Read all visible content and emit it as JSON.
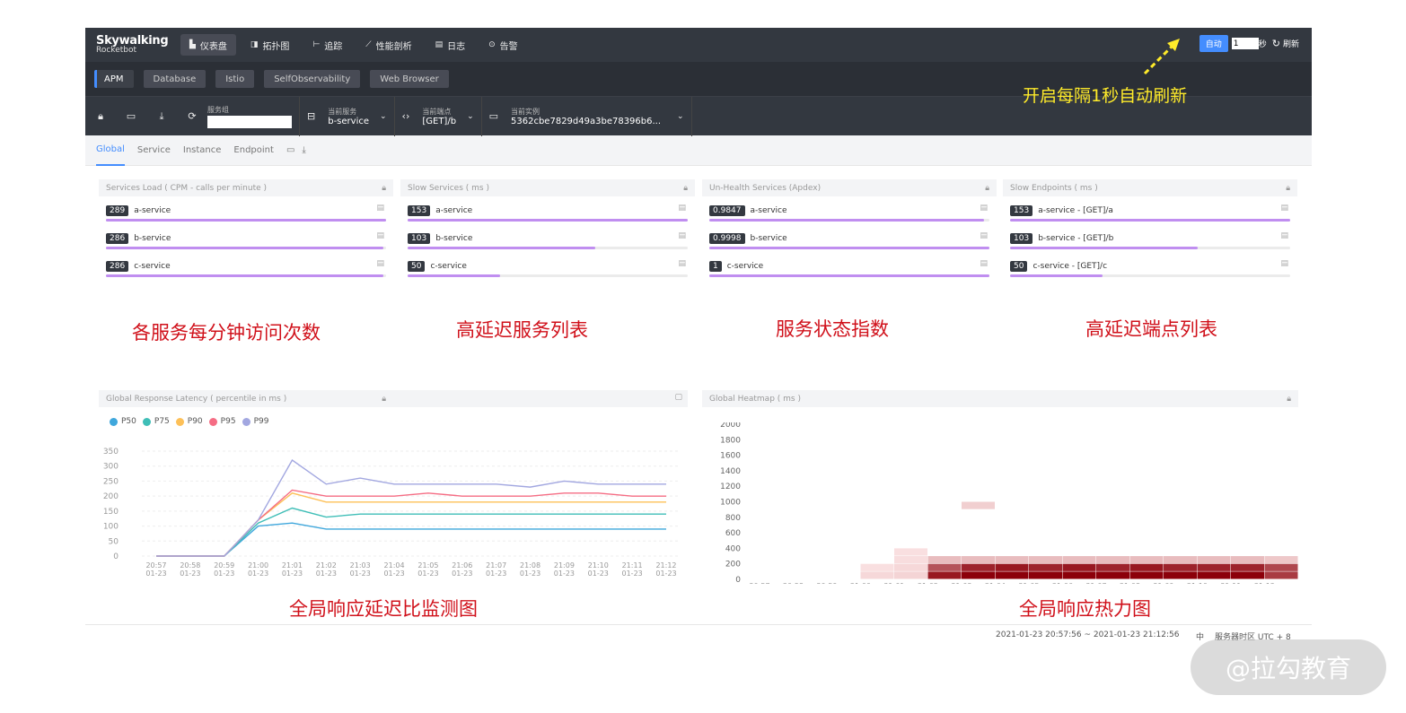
{
  "nav": {
    "logo_line1": "Skywalking",
    "logo_line2": "Rocketbot",
    "items": [
      {
        "label": "仪表盘",
        "icon": "dashboard-icon",
        "glyph": "▙"
      },
      {
        "label": "拓扑图",
        "icon": "topology-icon",
        "glyph": "◨"
      },
      {
        "label": "追踪",
        "icon": "trace-icon",
        "glyph": "⊢"
      },
      {
        "label": "性能剖析",
        "icon": "profile-icon",
        "glyph": "⟋"
      },
      {
        "label": "日志",
        "icon": "log-icon",
        "glyph": "▤"
      },
      {
        "label": "告警",
        "icon": "alarm-icon",
        "glyph": "⊙"
      }
    ],
    "auto_label": "自动",
    "interval_value": "1",
    "seconds_label": "秒",
    "refresh_label": "刷新"
  },
  "subnav": {
    "tabs": [
      "APM",
      "Database",
      "Istio",
      "SelfObservability",
      "Web Browser"
    ]
  },
  "toolbar": {
    "group_label": "服务组",
    "service_label": "当前服务",
    "service_value": "b-service",
    "endpoint_label": "当前端点",
    "endpoint_value": "[GET]/b",
    "instance_label": "当前实例",
    "instance_value": "5362cbe7829d49a3be78396b6..."
  },
  "lightbar": {
    "tabs": [
      "Global",
      "Service",
      "Instance",
      "Endpoint"
    ]
  },
  "panels": [
    {
      "title": "Services Load ( CPM - calls per minute )",
      "rows": [
        {
          "value": "289",
          "name": "a-service",
          "fill": 1.0
        },
        {
          "value": "286",
          "name": "b-service",
          "fill": 0.99
        },
        {
          "value": "286",
          "name": "c-service",
          "fill": 0.99
        }
      ]
    },
    {
      "title": "Slow Services ( ms )",
      "rows": [
        {
          "value": "153",
          "name": "a-service",
          "fill": 1.0
        },
        {
          "value": "103",
          "name": "b-service",
          "fill": 0.67
        },
        {
          "value": "50",
          "name": "c-service",
          "fill": 0.33
        }
      ]
    },
    {
      "title": "Un-Health Services (Apdex)",
      "rows": [
        {
          "value": "0.9847",
          "name": "a-service",
          "fill": 0.98
        },
        {
          "value": "0.9998",
          "name": "b-service",
          "fill": 1.0
        },
        {
          "value": "1",
          "name": "c-service",
          "fill": 1.0
        }
      ]
    },
    {
      "title": "Slow Endpoints ( ms )",
      "rows": [
        {
          "value": "153",
          "name": "a-service - [GET]/a",
          "fill": 1.0
        },
        {
          "value": "103",
          "name": "b-service - [GET]/b",
          "fill": 0.67
        },
        {
          "value": "50",
          "name": "c-service - [GET]/c",
          "fill": 0.33
        }
      ]
    }
  ],
  "annotations": {
    "a1": "各服务每分钟访问次数",
    "a2": "高延迟服务列表",
    "a3": "服务状态指数",
    "a4": "高延迟端点列表",
    "a5": "全局响应延迟比监测图",
    "a6": "全局响应热力图",
    "auto_note": "开启每隔1秒自动刷新"
  },
  "latency": {
    "title": "Global Response Latency ( percentile in ms )",
    "chart_data": {
      "type": "line",
      "x": [
        "20:57\n01-23",
        "20:58\n01-23",
        "20:59\n01-23",
        "21:00\n01-23",
        "21:01\n01-23",
        "21:02\n01-23",
        "21:03\n01-23",
        "21:04\n01-23",
        "21:05\n01-23",
        "21:06\n01-23",
        "21:07\n01-23",
        "21:08\n01-23",
        "21:09\n01-23",
        "21:10\n01-23",
        "21:11\n01-23",
        "21:12\n01-23"
      ],
      "ylim": [
        0,
        350
      ],
      "yticks": [
        0,
        50,
        100,
        150,
        200,
        250,
        300,
        350
      ],
      "series": [
        {
          "name": "P50",
          "color": "#3fa7dc",
          "values": [
            0,
            0,
            0,
            100,
            110,
            90,
            90,
            90,
            90,
            90,
            90,
            90,
            90,
            90,
            90,
            90
          ]
        },
        {
          "name": "P75",
          "color": "#3fbeb7",
          "values": [
            0,
            0,
            0,
            110,
            160,
            130,
            140,
            140,
            140,
            140,
            140,
            140,
            140,
            140,
            140,
            140
          ]
        },
        {
          "name": "P90",
          "color": "#fdc058",
          "values": [
            0,
            0,
            0,
            120,
            210,
            180,
            180,
            180,
            180,
            180,
            180,
            180,
            180,
            180,
            180,
            180
          ]
        },
        {
          "name": "P95",
          "color": "#f56d84",
          "values": [
            0,
            0,
            0,
            120,
            220,
            200,
            200,
            200,
            210,
            200,
            200,
            200,
            210,
            210,
            200,
            200
          ]
        },
        {
          "name": "P99",
          "color": "#a2a7e0",
          "values": [
            0,
            0,
            0,
            120,
            320,
            240,
            260,
            240,
            240,
            240,
            240,
            230,
            250,
            240,
            240,
            240
          ]
        }
      ]
    }
  },
  "heatmap": {
    "title": "Global Heatmap ( ms )",
    "chart_data": {
      "type": "heatmap",
      "x": [
        "20:57\n01-23",
        "20:58\n01-23",
        "20:59\n01-23",
        "21:00\n01-23",
        "21:01\n01-23",
        "21:02\n01-23",
        "21:03\n01-23",
        "21:04\n01-23",
        "21:05\n01-23",
        "21:06\n01-23",
        "21:07\n01-23",
        "21:08\n01-23",
        "21:09\n01-23",
        "21:10\n01-23",
        "21:11\n01-23",
        "21:12\n01-23"
      ],
      "yticks": [
        0,
        200,
        400,
        600,
        800,
        1000,
        1200,
        1400,
        1600,
        1800,
        2000
      ],
      "ylim": [
        0,
        2000
      ],
      "bucket_size": 100,
      "cells": [
        {
          "x": 3,
          "b": 0,
          "v": 0.08
        },
        {
          "x": 3,
          "b": 1,
          "v": 0.05
        },
        {
          "x": 4,
          "b": 0,
          "v": 0.1
        },
        {
          "x": 4,
          "b": 1,
          "v": 0.08
        },
        {
          "x": 4,
          "b": 2,
          "v": 0.06
        },
        {
          "x": 4,
          "b": 3,
          "v": 0.05
        },
        {
          "x": 5,
          "b": 0,
          "v": 0.9
        },
        {
          "x": 5,
          "b": 1,
          "v": 0.65
        },
        {
          "x": 5,
          "b": 2,
          "v": 0.2
        },
        {
          "x": 6,
          "b": 0,
          "v": 1.0
        },
        {
          "x": 6,
          "b": 1,
          "v": 0.85
        },
        {
          "x": 6,
          "b": 2,
          "v": 0.2
        },
        {
          "x": 6,
          "b": 9,
          "v": 0.12
        },
        {
          "x": 7,
          "b": 0,
          "v": 1.0
        },
        {
          "x": 7,
          "b": 1,
          "v": 0.9
        },
        {
          "x": 7,
          "b": 2,
          "v": 0.2
        },
        {
          "x": 8,
          "b": 0,
          "v": 1.0
        },
        {
          "x": 8,
          "b": 1,
          "v": 0.85
        },
        {
          "x": 8,
          "b": 2,
          "v": 0.2
        },
        {
          "x": 9,
          "b": 0,
          "v": 1.0
        },
        {
          "x": 9,
          "b": 1,
          "v": 0.9
        },
        {
          "x": 9,
          "b": 2,
          "v": 0.2
        },
        {
          "x": 10,
          "b": 0,
          "v": 1.0
        },
        {
          "x": 10,
          "b": 1,
          "v": 0.85
        },
        {
          "x": 10,
          "b": 2,
          "v": 0.2
        },
        {
          "x": 11,
          "b": 0,
          "v": 1.0
        },
        {
          "x": 11,
          "b": 1,
          "v": 0.9
        },
        {
          "x": 11,
          "b": 2,
          "v": 0.2
        },
        {
          "x": 12,
          "b": 0,
          "v": 1.0
        },
        {
          "x": 12,
          "b": 1,
          "v": 0.85
        },
        {
          "x": 12,
          "b": 2,
          "v": 0.2
        },
        {
          "x": 13,
          "b": 0,
          "v": 1.0
        },
        {
          "x": 13,
          "b": 1,
          "v": 0.85
        },
        {
          "x": 13,
          "b": 2,
          "v": 0.2
        },
        {
          "x": 14,
          "b": 0,
          "v": 1.0
        },
        {
          "x": 14,
          "b": 1,
          "v": 0.85
        },
        {
          "x": 14,
          "b": 2,
          "v": 0.2
        },
        {
          "x": 15,
          "b": 0,
          "v": 0.75
        },
        {
          "x": 15,
          "b": 1,
          "v": 0.7
        },
        {
          "x": 15,
          "b": 2,
          "v": 0.15
        }
      ]
    }
  },
  "footer": {
    "range": "2021-01-23 20:57:56 ~ 2021-01-23 21:12:56",
    "lang": "中",
    "tz": "服务器时区 UTC + 8"
  },
  "watermark": "@拉勾教育"
}
